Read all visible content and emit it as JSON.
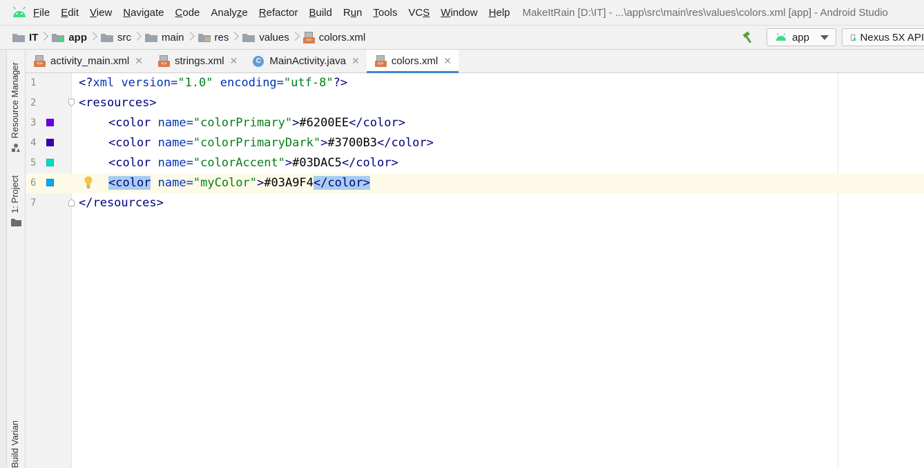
{
  "window_title": "MakeItRain [D:\\IT] - ...\\app\\src\\main\\res\\values\\colors.xml [app] - Android Studio",
  "menu": [
    {
      "mn": "F",
      "rest": "ile"
    },
    {
      "mn": "E",
      "rest": "dit"
    },
    {
      "mn": "V",
      "rest": "iew"
    },
    {
      "mn": "N",
      "rest": "avigate"
    },
    {
      "mn": "C",
      "rest": "ode"
    },
    {
      "mn": "",
      "pre": "Analy",
      "mn2": "z",
      "post": "e"
    },
    {
      "mn": "R",
      "rest": "efactor"
    },
    {
      "mn": "B",
      "rest": "uild"
    },
    {
      "mn": "",
      "pre": "R",
      "mn2": "u",
      "post": "n"
    },
    {
      "mn": "T",
      "rest": "ools"
    },
    {
      "mn": "",
      "pre": "VC",
      "mn2": "S",
      "post": ""
    },
    {
      "mn": "W",
      "rest": "indow"
    },
    {
      "mn": "H",
      "rest": "elp"
    }
  ],
  "breadcrumb": [
    "IT",
    "app",
    "src",
    "main",
    "res",
    "values",
    "colors.xml"
  ],
  "run_config": {
    "label": "app"
  },
  "device": {
    "label": "Nexus 5X API"
  },
  "tabs": [
    {
      "label": "activity_main.xml",
      "icon": "xml-file-icon",
      "active": false
    },
    {
      "label": "strings.xml",
      "icon": "xml-file-icon",
      "active": false
    },
    {
      "label": "MainActivity.java",
      "icon": "java-class-icon",
      "active": false
    },
    {
      "label": "colors.xml",
      "icon": "xml-file-icon",
      "active": true
    }
  ],
  "tool_windows": {
    "resource_manager": "Resource Manager",
    "project": "1: Project",
    "build_variants": "Build Variants"
  },
  "editor": {
    "current_line": 6,
    "lines": [
      {
        "num": "1",
        "swatch": null
      },
      {
        "num": "2",
        "swatch": null
      },
      {
        "num": "3",
        "swatch": "#6200EE"
      },
      {
        "num": "4",
        "swatch": "#3700B3"
      },
      {
        "num": "5",
        "swatch": "#03DAC5"
      },
      {
        "num": "6",
        "swatch": "#03A9F4"
      },
      {
        "num": "7",
        "swatch": null
      }
    ],
    "code": {
      "l1": {
        "a": "<?",
        "b": "xml ",
        "c": "version",
        "d": "=",
        "e": "\"1.0\"",
        "f": " ",
        "g": "encoding",
        "h": "=",
        "i": "\"utf-8\"",
        "j": "?>"
      },
      "l2": {
        "a": "<resources>"
      },
      "l3": {
        "open": "<color ",
        "attr": "name",
        "eq": "=",
        "val": "\"colorPrimary\"",
        "gt": ">",
        "text": "#6200EE",
        "close": "</color>"
      },
      "l4": {
        "open": "<color ",
        "attr": "name",
        "eq": "=",
        "val": "\"colorPrimaryDark\"",
        "gt": ">",
        "text": "#3700B3",
        "close": "</color>"
      },
      "l5": {
        "open": "<color ",
        "attr": "name",
        "eq": "=",
        "val": "\"colorAccent\"",
        "gt": ">",
        "text": "#03DAC5",
        "close": "</color>"
      },
      "l6": {
        "open": "<color",
        "sp": " ",
        "attr": "name",
        "eq": "=",
        "val": "\"myColor\"",
        "gt": ">",
        "text": "#03A9F4",
        "close": "</color>"
      },
      "l7": {
        "a": "</resources>"
      }
    }
  },
  "colors": {
    "accent_tab_underline": "#4083c9",
    "android_green": "#3ddc84",
    "selection": "#a7cdf1",
    "current_line": "#fdfbe8"
  }
}
